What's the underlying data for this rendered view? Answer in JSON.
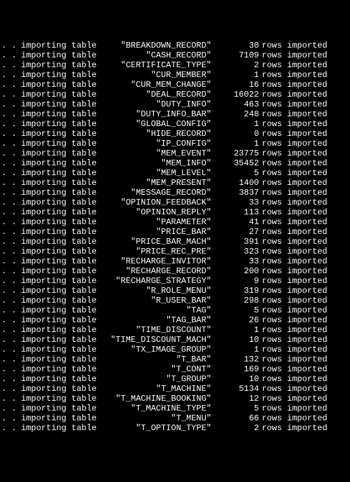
{
  "label_prefix": ". .",
  "label_text": "importing table",
  "suffix_text": "rows imported",
  "rows": [
    {
      "name": "\"BREAKDOWN_RECORD\"",
      "count": 30
    },
    {
      "name": "\"CASH_RECORD\"",
      "count": 7109
    },
    {
      "name": "\"CERTIFICATE_TYPE\"",
      "count": 2
    },
    {
      "name": "\"CUR_MEMBER\"",
      "count": 1
    },
    {
      "name": "\"CUR_MEM_CHANGE\"",
      "count": 16
    },
    {
      "name": "\"DEAL_RECORD\"",
      "count": 16022
    },
    {
      "name": "\"DUTY_INFO\"",
      "count": 463
    },
    {
      "name": "\"DUTY_INFO_BAR\"",
      "count": 248
    },
    {
      "name": "\"GLOBAL_CONFIG\"",
      "count": 1
    },
    {
      "name": "\"HIDE_RECORD\"",
      "count": 0
    },
    {
      "name": "\"IP_CONFIG\"",
      "count": 1
    },
    {
      "name": "\"MEM_EVENT\"",
      "count": 23775
    },
    {
      "name": "\"MEM_INFO\"",
      "count": 35452
    },
    {
      "name": "\"MEM_LEVEL\"",
      "count": 5
    },
    {
      "name": "\"MEM_PRESENT\"",
      "count": 1400
    },
    {
      "name": "\"MESSAGE_RECORD\"",
      "count": 3837
    },
    {
      "name": "\"OPINION_FEEDBACK\"",
      "count": 33
    },
    {
      "name": "\"OPINION_REPLY\"",
      "count": 113
    },
    {
      "name": "\"PARAMETER\"",
      "count": 41
    },
    {
      "name": "\"PRICE_BAR\"",
      "count": 27
    },
    {
      "name": "\"PRICE_BAR_MACH\"",
      "count": 391
    },
    {
      "name": "\"PRICE_REC_PRE\"",
      "count": 323
    },
    {
      "name": "\"RECHARGE_INVITOR\"",
      "count": 33
    },
    {
      "name": "\"RECHARGE_RECORD\"",
      "count": 200
    },
    {
      "name": "\"RECHARGE_STRATEGY\"",
      "count": 9
    },
    {
      "name": "\"R_ROLE_MENU\"",
      "count": 319
    },
    {
      "name": "\"R_USER_BAR\"",
      "count": 298
    },
    {
      "name": "\"TAG\"",
      "count": 5
    },
    {
      "name": "\"TAG_BAR\"",
      "count": 26
    },
    {
      "name": "\"TIME_DISCOUNT\"",
      "count": 1
    },
    {
      "name": "\"TIME_DISCOUNT_MACH\"",
      "count": 10
    },
    {
      "name": "\"TX_IMAGE_GROUP\"",
      "count": 1
    },
    {
      "name": "\"T_BAR\"",
      "count": 132
    },
    {
      "name": "\"T_CONT\"",
      "count": 169
    },
    {
      "name": "\"T_GROUP\"",
      "count": 10
    },
    {
      "name": "\"T_MACHINE\"",
      "count": 5134
    },
    {
      "name": "\"T_MACHINE_BOOKING\"",
      "count": 12
    },
    {
      "name": "\"T_MACHINE_TYPE\"",
      "count": 5
    },
    {
      "name": "\"T_MENU\"",
      "count": 66
    },
    {
      "name": "\"T_OPTION_TYPE\"",
      "count": 2
    }
  ]
}
